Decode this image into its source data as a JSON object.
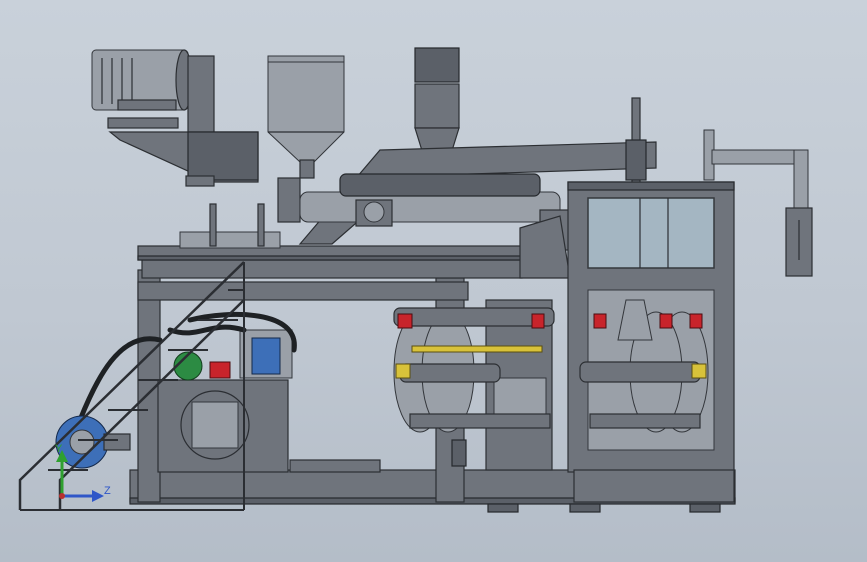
{
  "view": {
    "triad_axes": [
      "Y",
      "Z"
    ],
    "colors": {
      "background": "#c4ccd6",
      "steel": "#6f747c",
      "glass": "#aec2cf",
      "accent_red": "#c8242b",
      "accent_yellow": "#d8c23a",
      "accent_green": "#2c8b43",
      "accent_blue": "#3d6fb8",
      "axis_y": "#2fa02f",
      "axis_z": "#2f56c8"
    }
  }
}
